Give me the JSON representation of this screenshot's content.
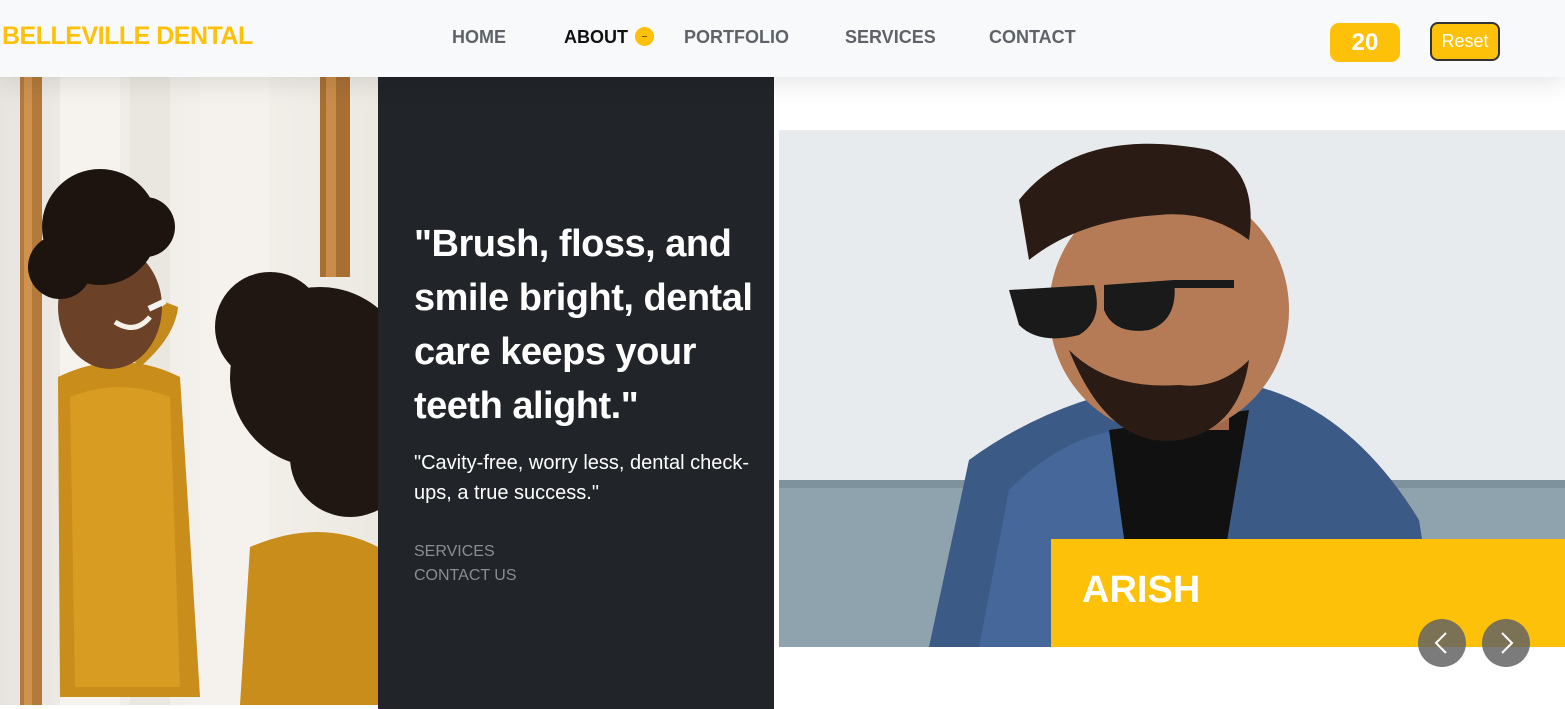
{
  "brand": {
    "name": "BELLEVILLE DENTAL"
  },
  "nav": {
    "items": [
      "HOME",
      "ABOUT",
      "PORTFOLIO",
      "SERVICES",
      "CONTACT"
    ],
    "active": "ABOUT"
  },
  "header": {
    "counter": "20",
    "reset_label": "Reset"
  },
  "hero": {
    "quote": "\"Brush, floss, and smile bright, dental care keeps your teeth alight.\"",
    "subquote": "\"Cavity-free, worry less, dental check-ups, a true success.\"",
    "links": [
      "SERVICES",
      "CONTACT US"
    ]
  },
  "carousel": {
    "name": "ARISH"
  },
  "colors": {
    "accent": "#fdc10a",
    "dark_panel": "#212529",
    "navbar_bg": "#f8f9fa",
    "nav_text": "#5f6368",
    "muted_link": "#8a8d91"
  },
  "icons": {
    "active_indicator": "dot-icon",
    "prev": "chevron-left-icon",
    "next": "chevron-right-icon"
  }
}
